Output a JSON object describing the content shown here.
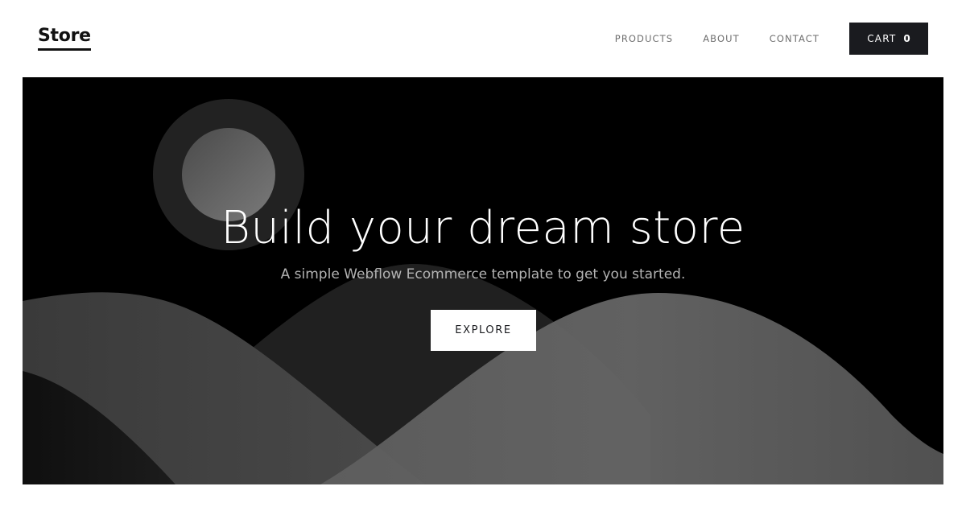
{
  "navbar": {
    "brand": "Store",
    "links": [
      {
        "label": "PRODUCTS"
      },
      {
        "label": "ABOUT"
      },
      {
        "label": "CONTACT"
      }
    ],
    "cart": {
      "label": "CART",
      "count": "0"
    }
  },
  "hero": {
    "heading": "Build your dream store",
    "subtitle": "A simple Webflow Ecommerce template to get you started.",
    "cta_label": "EXPLORE"
  },
  "colors": {
    "hero_background": "#000000",
    "cart_button": "#1a1b1f",
    "nav_link": "#6f6f6f"
  }
}
